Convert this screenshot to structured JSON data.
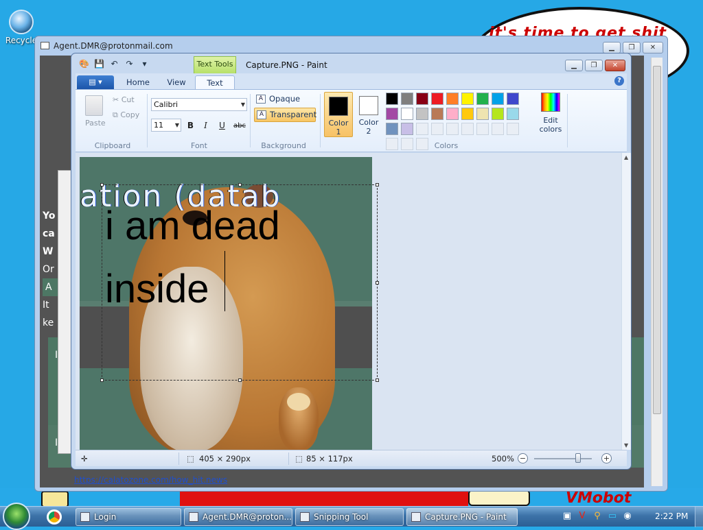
{
  "desktop": {
    "recycle_label": "Recycle",
    "bubble_text": "it's time to get shit",
    "bottom_art_text": "VMobot"
  },
  "background_window": {
    "title": "Agent.DMR@protonmail.com",
    "left_text_lines": [
      "Yo",
      "ca",
      "W",
      "Or",
      "A",
      "It",
      "ke"
    ],
    "link_text": "https://calatozone.com/how_hit.news",
    "teal_row_letters": [
      "I",
      "I"
    ]
  },
  "paint": {
    "context_tab": "Text Tools",
    "title": "Capture.PNG - Paint",
    "tabs": [
      "Home",
      "View",
      "Text"
    ],
    "active_tab": "Text",
    "clipboard": {
      "paste": "Paste",
      "cut": "Cut",
      "copy": "Copy",
      "group": "Clipboard"
    },
    "font": {
      "family": "Calibri",
      "size": "11",
      "bold": "B",
      "italic": "I",
      "underline": "U",
      "strike": "abc",
      "group": "Font"
    },
    "background": {
      "opaque": "Opaque",
      "transparent": "Transparent",
      "selected": "Transparent",
      "group": "Background"
    },
    "colors": {
      "color1_label": "Color\n1",
      "color1_top": "Color",
      "color1_num": "1",
      "color2_top": "Color",
      "color2_num": "2",
      "color1": "#000000",
      "color2": "#ffffff",
      "palette_row1": [
        "#000000",
        "#7f7f7f",
        "#880015",
        "#ed1c24",
        "#ff7f27",
        "#fff200",
        "#22b14c",
        "#00a2e8",
        "#3f48cc",
        "#a349a4"
      ],
      "palette_row2": [
        "#ffffff",
        "#c3c3c3",
        "#b97a57",
        "#ffaec9",
        "#ffc90e",
        "#efe4b0",
        "#b5e61d",
        "#99d9ea",
        "#7092be",
        "#c8bfe7"
      ],
      "edit_colors_line1": "Edit",
      "edit_colors_line2": "colors",
      "group": "Colors"
    },
    "canvas": {
      "overlay_text": "ation  (datab",
      "text_line1": "i am dead",
      "text_line2": "inside"
    },
    "status": {
      "canvas_size": "405 × 290px",
      "selection_size": "85 × 117px",
      "zoom": "500%"
    }
  },
  "taskbar": {
    "buttons": [
      {
        "label": "Login"
      },
      {
        "label": "Agent.DMR@proton..."
      },
      {
        "label": "Snipping Tool"
      },
      {
        "label": "Capture.PNG - Paint"
      }
    ],
    "clock": "2:22 PM"
  }
}
